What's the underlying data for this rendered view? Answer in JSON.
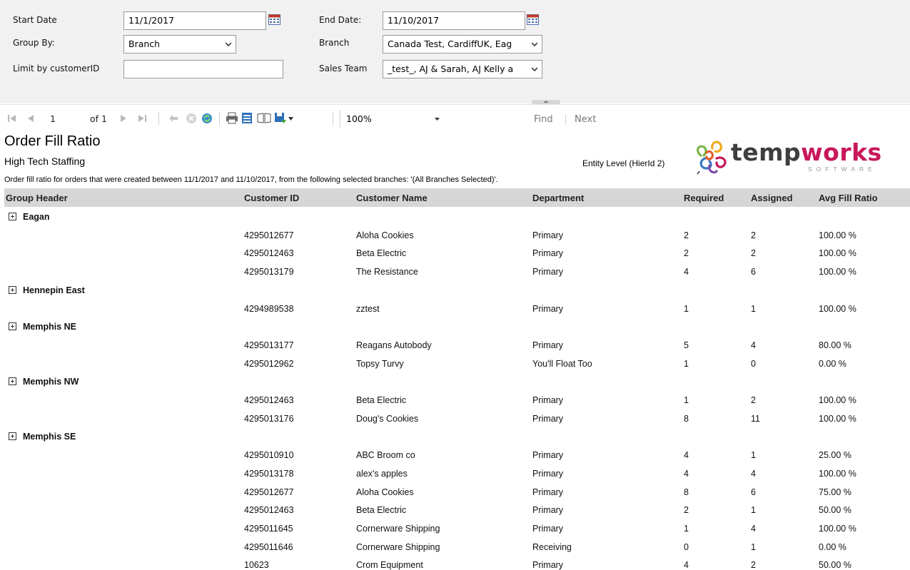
{
  "params": {
    "start_date_label": "Start Date",
    "start_date_value": "11/1/2017",
    "end_date_label": "End Date:",
    "end_date_value": "11/10/2017",
    "group_by_label": "Group By:",
    "group_by_value": "Branch",
    "branch_label": "Branch",
    "branch_value": "Canada Test, CardiffUK, Eag",
    "limit_label": "Limit by customerID",
    "limit_value": "",
    "sales_team_label": "Sales Team",
    "sales_team_value": "_test_, AJ & Sarah, AJ Kelly a"
  },
  "toolbar": {
    "page_value": "1",
    "page_of": "of 1",
    "zoom_value": "100%",
    "find_label": "Find",
    "next_label": "Next"
  },
  "report": {
    "title": "Order Fill Ratio",
    "subtitle": "High Tech Staffing",
    "entity": "Entity Level (HierId 2)",
    "description": "Order fill ratio for orders that were created between 11/1/2017 and 11/10/2017, from the following selected branches: '(All Branches Selected)'.",
    "logo_word_a": "temp",
    "logo_word_b": "works",
    "logo_sub": "SOFTWARE",
    "columns": [
      "Group Header",
      "Customer ID",
      "Customer Name",
      "Department",
      "Required",
      "Assigned",
      "Avg Fill Ratio"
    ],
    "groups": [
      {
        "name": "Eagan",
        "rows": [
          [
            "4295012677",
            "Aloha Cookies",
            "Primary",
            "2",
            "2",
            "100.00 %"
          ],
          [
            "4295012463",
            "Beta Electric",
            "Primary",
            "2",
            "2",
            "100.00 %"
          ],
          [
            "4295013179",
            "The Resistance",
            "Primary",
            "4",
            "6",
            "100.00 %"
          ]
        ]
      },
      {
        "name": "Hennepin East",
        "rows": [
          [
            "4294989538",
            "zztest",
            "Primary",
            "1",
            "1",
            "100.00 %"
          ]
        ]
      },
      {
        "name": "Memphis NE",
        "rows": [
          [
            "4295013177",
            "Reagans Autobody",
            "Primary",
            "5",
            "4",
            "80.00 %"
          ],
          [
            "4295012962",
            "Topsy Turvy",
            "You'll Float Too",
            "1",
            "0",
            "0.00 %"
          ]
        ]
      },
      {
        "name": "Memphis NW",
        "rows": [
          [
            "4295012463",
            "Beta Electric",
            "Primary",
            "1",
            "2",
            "100.00 %"
          ],
          [
            "4295013176",
            "Doug's Cookies",
            "Primary",
            "8",
            "11",
            "100.00 %"
          ]
        ]
      },
      {
        "name": "Memphis SE",
        "rows": [
          [
            "4295010910",
            " ABC Broom co",
            "Primary",
            "4",
            "1",
            "25.00 %"
          ],
          [
            "4295013178",
            "alex's apples",
            "Primary",
            "4",
            "4",
            "100.00 %"
          ],
          [
            "4295012677",
            "Aloha Cookies",
            "Primary",
            "8",
            "6",
            "75.00 %"
          ],
          [
            "4295012463",
            "Beta Electric",
            "Primary",
            "2",
            "1",
            "50.00 %"
          ],
          [
            "4295011645",
            "Cornerware Shipping",
            "Primary",
            "1",
            "4",
            "100.00 %"
          ],
          [
            "4295011646",
            "Cornerware Shipping",
            "Receiving",
            "0",
            "1",
            "0.00 %"
          ],
          [
            "10623",
            "Crom Equipment",
            "Primary",
            "4",
            "2",
            "50.00 %"
          ]
        ]
      }
    ]
  }
}
